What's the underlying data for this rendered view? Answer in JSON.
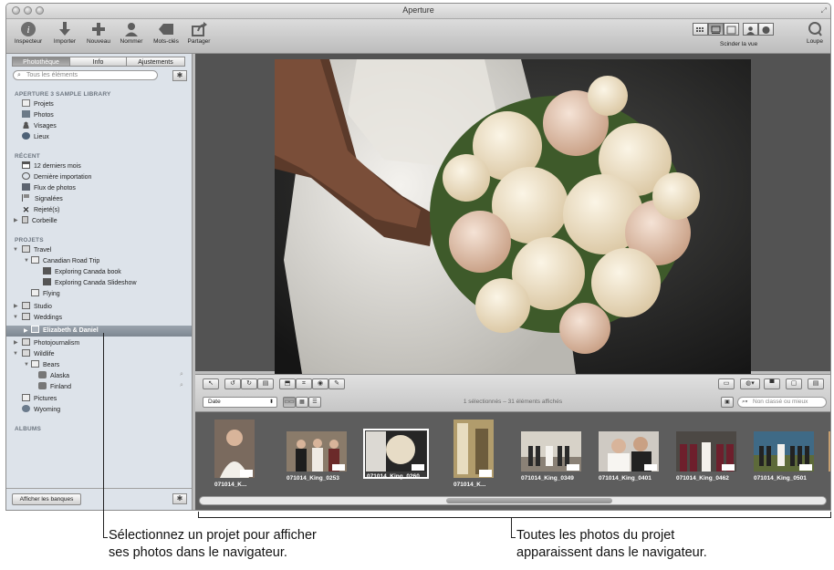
{
  "window": {
    "title": "Aperture"
  },
  "toolbar": {
    "buttons": [
      {
        "label": "Inspecteur"
      },
      {
        "label": "Importer"
      },
      {
        "label": "Nouveau"
      },
      {
        "label": "Nommer"
      },
      {
        "label": "Mots-clés"
      },
      {
        "label": "Partager"
      }
    ],
    "view_label": "Scinder la vue",
    "loupe_label": "Loupe"
  },
  "sidebar": {
    "tabs": [
      {
        "label": "Photothèque",
        "selected": true
      },
      {
        "label": "Info",
        "selected": false
      },
      {
        "label": "Ajustements",
        "selected": false
      }
    ],
    "search_placeholder": "Tous les éléments",
    "library_header": "APERTURE 3 SAMPLE LIBRARY",
    "library_items": [
      "Projets",
      "Photos",
      "Visages",
      "Lieux"
    ],
    "recent_header": "RÉCENT",
    "recent_items": [
      "12 derniers mois",
      "Dernière importation",
      "Flux de photos",
      "Signalées",
      "Rejeté(s)",
      "Corbeille"
    ],
    "projects_header": "PROJETS",
    "projects": [
      "Travel",
      "Canadian Road Trip",
      "Exploring Canada book",
      "Exploring Canada Slideshow",
      "Flying",
      "Studio",
      "Weddings",
      "Elizabeth & Daniel",
      "Photojournalism",
      "Wildlife",
      "Bears",
      "Alaska",
      "Finland",
      "Pictures",
      "Wyoming"
    ],
    "albums_header": "ALBUMS",
    "vaults_button": "Afficher les banques"
  },
  "controls": {
    "sort_value": "Date",
    "status": "1 sélectionnés – 31 éléments affichés",
    "filter_placeholder": "Non classé ou mieux"
  },
  "browser": {
    "thumbnails": [
      "071014_K...",
      "071014_King_0253",
      "071014_King_0260",
      "071014_K...",
      "071014_King_0349",
      "071014_King_0401",
      "071014_King_0462",
      "071014_King_0501"
    ]
  },
  "callouts": {
    "left_line1": "Sélectionnez un projet pour afficher",
    "left_line2": "ses photos dans le navigateur.",
    "right_line1": "Toutes les photos du projet",
    "right_line2": "apparaissent dans le navigateur."
  }
}
